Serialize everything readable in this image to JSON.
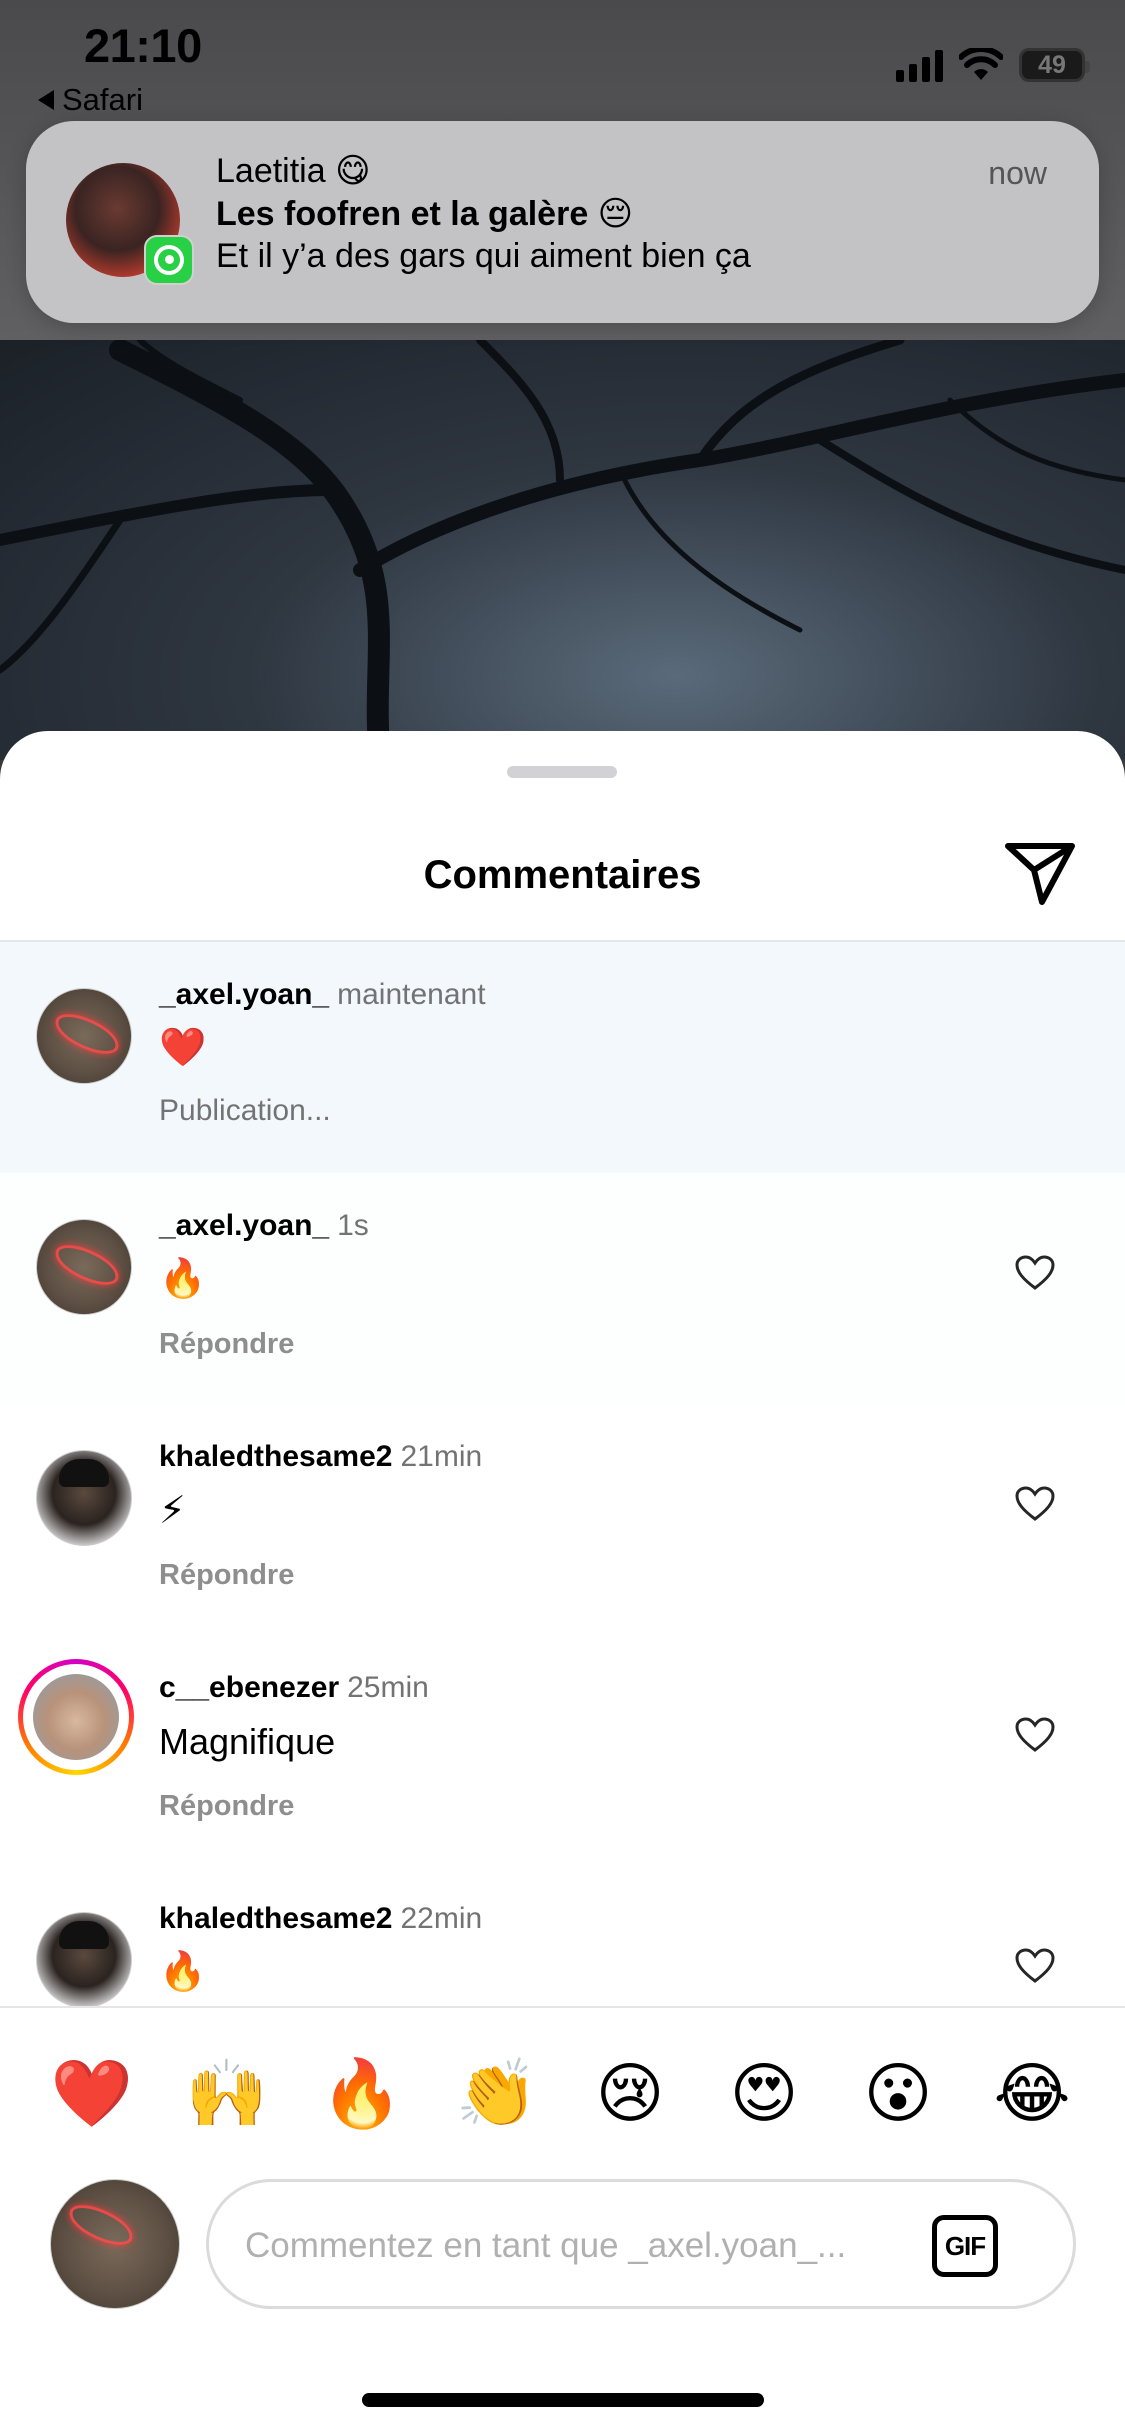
{
  "status_bar": {
    "time": "21:10",
    "back_app": "Safari",
    "battery": "49"
  },
  "notification": {
    "app": "whatsapp-icon",
    "sender": "Laetitia 😋",
    "title": "Les foofren et la galère 😔",
    "body": "Et il y’a des gars qui aiment bien ça",
    "time": "now"
  },
  "sheet": {
    "title": "Commentaires"
  },
  "comments": [
    {
      "user": "_axel.yoan_",
      "time": "maintenant",
      "text": "❤️",
      "status": "Publication...",
      "avatar": "axel"
    },
    {
      "user": "_axel.yoan_",
      "time": "1s",
      "text": "🔥",
      "reply": "Répondre",
      "avatar": "axel"
    },
    {
      "user": "khaledthesame2",
      "time": "21min",
      "text": "⚡",
      "reply": "Répondre",
      "avatar": "khaled"
    },
    {
      "user": "c__ebenezer",
      "time": "25min",
      "text": "Magnifique",
      "reply": "Répondre",
      "avatar": "ebenezer"
    },
    {
      "user": "khaledthesame2",
      "time": "22min",
      "text": "🔥",
      "avatar": "khaled"
    }
  ],
  "reactions": [
    "❤️",
    "🙌",
    "🔥",
    "👏",
    "😢",
    "😍",
    "😮",
    "😂"
  ],
  "composer": {
    "placeholder": "Commentez en tant que _axel.yoan_...",
    "gif_label": "GIF"
  },
  "colors": {
    "like_heart_outline": "#262626",
    "story_ring": "#ff0069",
    "pending_bg": "#f3f8fd"
  }
}
